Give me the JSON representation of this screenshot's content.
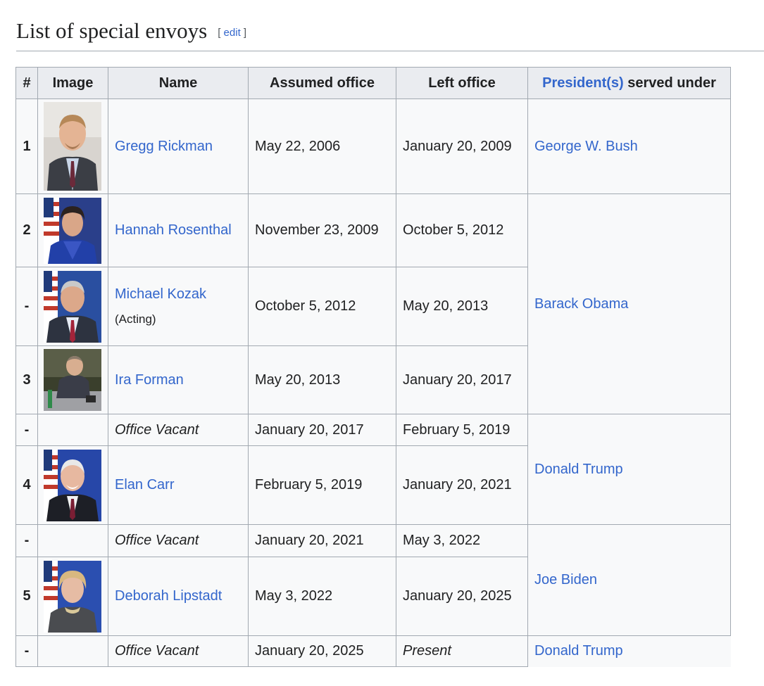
{
  "heading": {
    "title": "List of special envoys",
    "edit_open": "[ ",
    "edit_label": "edit",
    "edit_close": " ]"
  },
  "table": {
    "headers": {
      "num": "#",
      "image": "Image",
      "name": "Name",
      "assumed": "Assumed office",
      "left": "Left office",
      "president_link": "President(s)",
      "president_rest": " served under"
    },
    "rows": [
      {
        "num": "1",
        "name": "Gregg Rickman",
        "assumed": "May 22, 2006",
        "left": "January 20, 2009"
      },
      {
        "num": "2",
        "name": "Hannah Rosenthal",
        "assumed": "November 23, 2009",
        "left": "October 5, 2012"
      },
      {
        "num": "-",
        "name": "Michael Kozak",
        "note": "(Acting)",
        "assumed": "October 5, 2012",
        "left": "May 20, 2013"
      },
      {
        "num": "3",
        "name": "Ira Forman",
        "assumed": "May 20, 2013",
        "left": "January 20, 2017"
      },
      {
        "num": "-",
        "name": "Office Vacant",
        "assumed": "January 20, 2017",
        "left": "February 5, 2019"
      },
      {
        "num": "4",
        "name": "Elan Carr",
        "assumed": "February 5, 2019",
        "left": "January 20, 2021"
      },
      {
        "num": "-",
        "name": "Office Vacant",
        "assumed": "January 20, 2021",
        "left": "May 3, 2022"
      },
      {
        "num": "5",
        "name": "Deborah Lipstadt",
        "assumed": "May 3, 2022",
        "left": "January 20, 2025"
      },
      {
        "num": "-",
        "name": "Office Vacant",
        "assumed": "January 20, 2025",
        "left": "Present"
      }
    ],
    "presidents": [
      "George W. Bush",
      "Barack Obama",
      "Donald Trump",
      "Joe Biden",
      "Donald Trump"
    ]
  },
  "colors": {
    "link": "#3366cc",
    "header_bg": "#eaecf0",
    "cell_bg": "#f8f9fa",
    "border": "#a2a9b1"
  }
}
